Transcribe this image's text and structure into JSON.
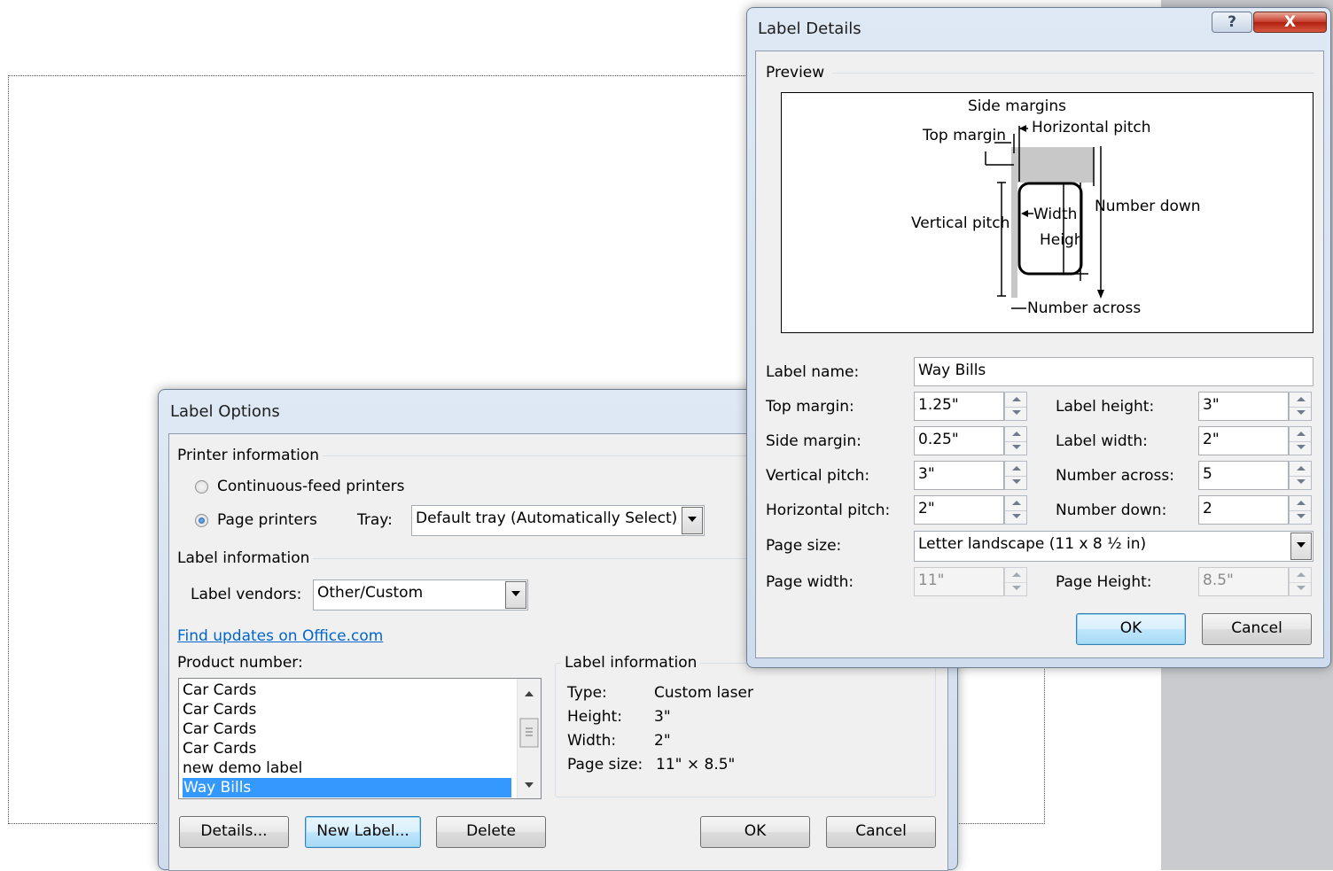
{
  "label_options": {
    "title": "Label Options",
    "printer_group": "Printer information",
    "continuous_feed": "Continuous-feed printers",
    "page_printers": "Page printers",
    "tray_label": "Tray:",
    "tray_value": "Default tray (Automatically Select)",
    "label_info_group": "Label information",
    "vendors_label": "Label vendors:",
    "vendors_value": "Other/Custom",
    "find_updates": "Find updates on Office.com",
    "product_number_label": "Product number:",
    "products": [
      "Car Cards",
      "Car Cards",
      "Car Cards",
      "Car Cards",
      "new demo label",
      "Way Bills"
    ],
    "selected_product": "Way Bills",
    "info_group": "Label information",
    "info": {
      "type_label": "Type:",
      "type_value": "Custom laser",
      "height_label": "Height:",
      "height_value": "3\"",
      "width_label": "Width:",
      "width_value": "2\"",
      "page_size_label": "Page size:",
      "page_size_value": "11\" × 8.5\""
    },
    "buttons": {
      "details": "Details...",
      "new_label": "New Label...",
      "delete": "Delete",
      "ok": "OK",
      "cancel": "Cancel"
    }
  },
  "label_details": {
    "title": "Label Details",
    "help_glyph": "?",
    "close_glyph": "X",
    "preview_group": "Preview",
    "preview_labels": {
      "side_margins": "Side margins",
      "horizontal_pitch": "Horizontal pitch",
      "top_margin": "Top margin",
      "vertical_pitch": "Vertical pitch",
      "width": "Width",
      "height": "Height",
      "number_down": "Number down",
      "number_across": "Number across"
    },
    "fields": {
      "label_name_label": "Label name:",
      "label_name_value": "Way Bills",
      "top_margin_label": "Top margin:",
      "top_margin_value": "1.25\"",
      "side_margin_label": "Side margin:",
      "side_margin_value": "0.25\"",
      "vertical_pitch_label": "Vertical pitch:",
      "vertical_pitch_value": "3\"",
      "horizontal_pitch_label": "Horizontal pitch:",
      "horizontal_pitch_value": "2\"",
      "label_height_label": "Label height:",
      "label_height_value": "3\"",
      "label_width_label": "Label width:",
      "label_width_value": "2\"",
      "number_across_label": "Number across:",
      "number_across_value": "5",
      "number_down_label": "Number down:",
      "number_down_value": "2",
      "page_size_label": "Page size:",
      "page_size_value": "Letter landscape (11 x 8 ½ in)",
      "page_width_label": "Page width:",
      "page_width_value": "11\"",
      "page_height_label": "Page Height:",
      "page_height_value": "8.5\""
    },
    "buttons": {
      "ok": "OK",
      "cancel": "Cancel"
    }
  }
}
